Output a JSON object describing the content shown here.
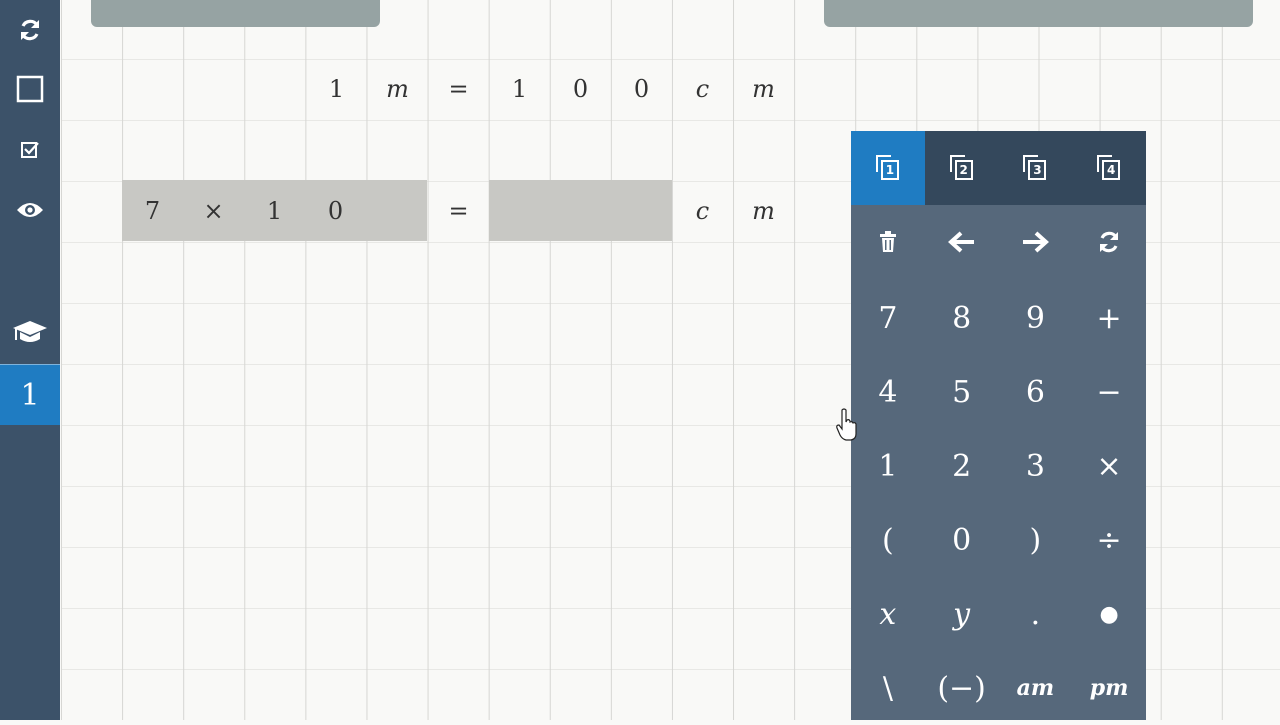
{
  "sidebar": {
    "refresh_icon": "refresh-icon",
    "square_icon": "square-icon",
    "checkbox_icon": "checkbox-icon",
    "eye_icon": "eye-icon",
    "graduation_icon": "graduation-cap-icon",
    "page_number": "1"
  },
  "row1": [
    "1",
    "m",
    "=",
    "1",
    "0",
    "0",
    "c",
    "m"
  ],
  "row2": {
    "cells": [
      "7",
      "×",
      "1",
      "0"
    ],
    "equals": "=",
    "units": [
      "c",
      "m"
    ]
  },
  "keypad": {
    "tabs": [
      "1",
      "2",
      "3",
      "4"
    ],
    "active_tab": "1",
    "nav_row": [
      "trash-icon",
      "arrow-left-icon",
      "arrow-right-icon",
      "refresh-icon"
    ],
    "keys": [
      [
        "7",
        "8",
        "9",
        "+"
      ],
      [
        "4",
        "5",
        "6",
        "−"
      ],
      [
        "1",
        "2",
        "3",
        "×"
      ],
      [
        "(",
        "0",
        ")",
        "÷"
      ],
      [
        "x",
        "y",
        ".",
        "●"
      ],
      [
        "\\",
        "(−)",
        "am",
        "pm"
      ]
    ]
  },
  "colors": {
    "sidebar": "#3c5269",
    "accent": "#1f7cc2",
    "keypad": "#56687b",
    "keypad_tabs": "#34485c",
    "shaded_cell": "#c8c8c4"
  }
}
